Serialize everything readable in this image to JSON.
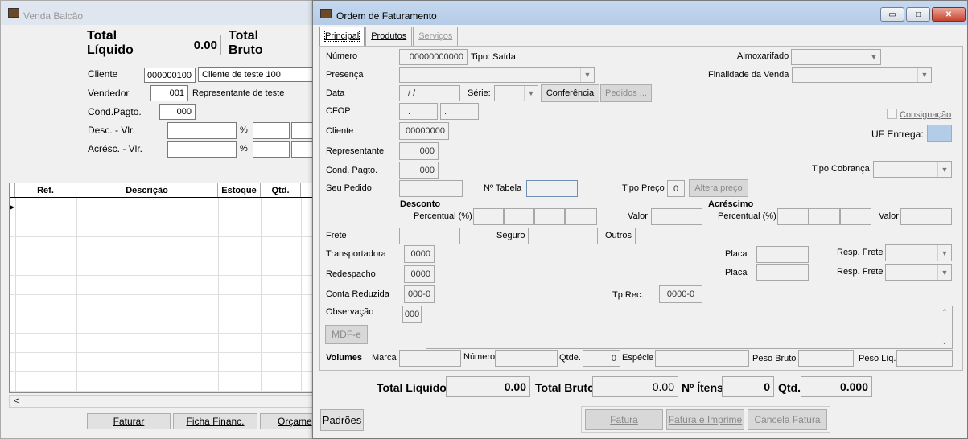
{
  "bg": {
    "title": "Venda Balcão",
    "total_liquido_label": "Total Líquido",
    "total_liquido_value": "0.00",
    "total_bruto_label": "Total Bruto",
    "cliente_label": "Cliente",
    "cliente_code": "000000100",
    "cliente_name": "Cliente de teste 100",
    "vendedor_label": "Vendedor",
    "vendedor_code": "001",
    "vendedor_name": "Representante de teste",
    "condpagto_label": "Cond.Pagto.",
    "condpagto_code": "000",
    "desc_label": "Desc. - Vlr.",
    "acresc_label": "Acrésc. - Vlr.",
    "pct": "%",
    "grid_headers": [
      "Ref.",
      "Descrição",
      "Estoque",
      "Qtd."
    ],
    "scroll_left": "<",
    "buttons": [
      "Faturar",
      "Ficha Financ.",
      "Orçame"
    ]
  },
  "win": {
    "title": "Ordem de Faturamento",
    "controls": [
      "▭",
      "□",
      "✕"
    ],
    "tabs": [
      "Principal",
      "Produtos",
      "Serviços"
    ],
    "numero_label": "Número",
    "numero_value": "00000000000",
    "tipo": "Tipo: Saída",
    "almox_label": "Almoxarifado",
    "presenca_label": "Presença",
    "finalidade_label": "Finalidade da Venda",
    "data_label": "Data",
    "data_value": "/ /",
    "serie_label": "Série:",
    "conferencia": "Conferência",
    "pedidos": "Pedidos ...",
    "cfop_label": "CFOP",
    "cfop_a": ".",
    "cfop_b": ".",
    "consignacao": "Consignação",
    "cliente_label": "Cliente",
    "cliente_value": "00000000",
    "uf_label": "UF Entrega:",
    "representante_label": "Representante",
    "representante_value": "000",
    "condpagto_label": "Cond. Pagto.",
    "condpagto_value": "000",
    "tipo_cobranca_label": "Tipo Cobrança",
    "seu_pedido_label": "Seu Pedido",
    "n_tabela_label": "Nº Tabela",
    "tipo_preco_label": "Tipo Preço",
    "tipo_preco_value": "0",
    "altera_preco": "Altera preço",
    "desconto_label": "Desconto",
    "acrescimo_label": "Acréscimo",
    "percentual_label": "Percentual (%)",
    "valor_label": "Valor",
    "frete_label": "Frete",
    "seguro_label": "Seguro",
    "outros_label": "Outros",
    "transportadora_label": "Transportadora",
    "transportadora_value": "0000",
    "redespacho_label": "Redespacho",
    "redespacho_value": "0000",
    "placa_label": "Placa",
    "resp_frete_label": "Resp. Frete",
    "conta_reduzida_label": "Conta Reduzida",
    "conta_reduzida_value": "000-0",
    "tp_rec_label": "Tp.Rec.",
    "tp_rec_value": "0000-0",
    "observacao_label": "Observação",
    "observacao_code": "000",
    "mdfe": "MDF-e",
    "volumes_label": "Volumes",
    "marca_label": "Marca",
    "numero2_label": "Número",
    "qtde_label": "Qtde.",
    "qtde_value": "0",
    "especie_label": "Espécie",
    "peso_bruto_label": "Peso Bruto",
    "peso_liq_label": "Peso Líq.",
    "total_liquido_label": "Total Líquido",
    "total_liquido_value": "0.00",
    "total_bruto_label": "Total Bruto",
    "total_bruto_value": "0.00",
    "n_itens_label": "Nº Ítens",
    "n_itens_value": "0",
    "qtd_label": "Qtd.",
    "qtd_value": "0.000",
    "padroes": "Padrões",
    "fatura": "Fatura",
    "fatura_imprime": "Fatura e Imprime",
    "cancela_fatura": "Cancela Fatura"
  }
}
